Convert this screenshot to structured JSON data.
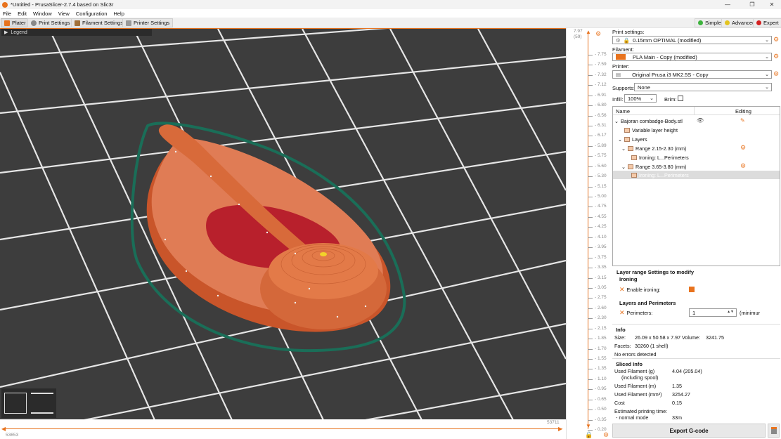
{
  "window": {
    "title": "*Untitled - PrusaSlicer-2.7.4 based on Slic3r"
  },
  "menu": [
    "File",
    "Edit",
    "Window",
    "View",
    "Configuration",
    "Help"
  ],
  "tabs": [
    "Plater",
    "Print Settings",
    "Filament Settings",
    "Printer Settings"
  ],
  "modes": [
    "Simple",
    "Advanced",
    "Expert"
  ],
  "colors": {
    "accent": "#e8731e",
    "simple": "#3db33d",
    "advanced": "#e3c420",
    "expert": "#d42020",
    "model": "#e0794f",
    "outline": "#1a6e58"
  },
  "viewport": {
    "legend": "Legend"
  },
  "hslider": {
    "left_value": "53653",
    "right_value": "53711"
  },
  "vslider": {
    "top_value": "7.97",
    "top_sub": "(59)",
    "ticks": [
      "7.75",
      "7.59",
      "7.32",
      "7.12",
      "6.91",
      "6.80",
      "6.56",
      "6.31",
      "6.17",
      "5.89",
      "5.75",
      "5.60",
      "5.30",
      "5.15",
      "5.00",
      "4.75",
      "4.55",
      "4.25",
      "4.10",
      "3.95",
      "3.75",
      "3.35",
      "3.15",
      "3.05",
      "2.75",
      "2.60",
      "2.30",
      "2.15",
      "1.85",
      "1.70",
      "1.55",
      "1.35",
      "1.10",
      "0.95",
      "0.65",
      "0.50",
      "0.35",
      "0.20"
    ]
  },
  "print": {
    "label": "Print settings:",
    "value": "0.15mm OPTIMAL (modified)"
  },
  "filament": {
    "label": "Filament:",
    "value": "PLA Main - Copy (modified)"
  },
  "printer": {
    "label": "Printer:",
    "value": "Original Prusa i3 MK2.5S - Copy"
  },
  "supports": {
    "label": "Supports:",
    "value": "None"
  },
  "infill": {
    "label": "Infill:",
    "value": "100%"
  },
  "brim": {
    "label": "Brim:"
  },
  "tree": {
    "col_name": "Name",
    "col_editing": "Editing",
    "rows": [
      "Bajoran combadge-Body.stl",
      "Variable layer height",
      "Layers",
      "Range 2.15-2.30 (mm)",
      "Ironing: L...Perimeters",
      "Range 3.65-3.80 (mm)",
      "Ironing: L...Perimeters"
    ]
  },
  "settings": {
    "header": "Layer range Settings to modify",
    "ironing_group": "Ironing",
    "enable_ironing": "Enable ironing:",
    "layers_group": "Layers and Perimeters",
    "perimeters": "Perimeters:",
    "perimeters_value": "1",
    "perimeters_unit": "(minimur"
  },
  "info": {
    "title": "Info",
    "size_label": "Size:",
    "size_value": "26.09 x 50.58 x 7.97",
    "volume_label": "Volume:",
    "volume_value": "3241.75",
    "facets_label": "Facets:",
    "facets_value": "30260 (1 shell)",
    "errors": "No errors detected"
  },
  "sliced": {
    "title": "Sliced Info",
    "rows": [
      {
        "label": "Used Filament (g)",
        "value": "4.04 (205.04)"
      },
      {
        "label": "(including spool)",
        "value": ""
      },
      {
        "label": "Used Filament (m)",
        "value": "1.35"
      },
      {
        "label": "Used Filament (mm³)",
        "value": "3254.27"
      },
      {
        "label": "Cost",
        "value": "0.15"
      },
      {
        "label": "Estimated printing time:",
        "value": ""
      },
      {
        "label": "- normal mode",
        "value": "33m"
      }
    ]
  },
  "export_label": "Export G-code"
}
